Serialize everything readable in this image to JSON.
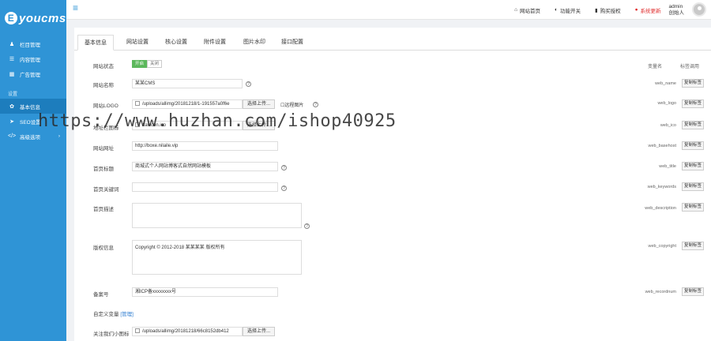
{
  "brand": {
    "logo_e": "E",
    "logo_text": "youcms"
  },
  "sidebar": {
    "items": [
      {
        "icon": "♟",
        "label": "栏目管理"
      },
      {
        "icon": "☰",
        "label": "内容管理"
      },
      {
        "icon": "▦",
        "label": "广告管理"
      }
    ],
    "section": "设置",
    "items2": [
      {
        "icon": "✿",
        "label": "基本信息"
      },
      {
        "icon": "➤",
        "label": "SEO设置"
      },
      {
        "icon": "</>",
        "label": "高级选项",
        "arrow": "›"
      }
    ]
  },
  "topbar": {
    "links": [
      {
        "icon": "⌂",
        "label": "网站首页"
      },
      {
        "icon": "◐",
        "label": "功能开关"
      },
      {
        "icon": "▮",
        "label": "购买授权"
      },
      {
        "icon": "●",
        "label": "系统更新"
      }
    ],
    "user": {
      "name": "admin",
      "role": "创始人"
    }
  },
  "tabs": [
    "基本信息",
    "网站设置",
    "核心设置",
    "附件设置",
    "图片水印",
    "接口配置"
  ],
  "headers": {
    "var": "变量名",
    "call": "标签调用"
  },
  "form": {
    "status": {
      "label": "网站状态",
      "on": "开启",
      "off": "关闭"
    },
    "name": {
      "label": "网站名称",
      "value": "某某CMS",
      "var": "web_name",
      "btn": "复制标签"
    },
    "logo": {
      "label": "网站LOGO",
      "value": "/uploads/allimg/20181218/1-191557a0f6e",
      "upload": "选择上传...",
      "remote": "远程图片",
      "var": "web_logo",
      "btn": "复制标签"
    },
    "ico": {
      "label": "地址栏图标",
      "value": "/favicon.ico",
      "upload": "选择上传...",
      "var": "web_ico",
      "btn": "复制标签"
    },
    "url": {
      "label": "网站网址",
      "value": "http://boxe.nilaile.vip",
      "var": "web_basehost",
      "btn": "复制标签"
    },
    "title": {
      "label": "首页标题",
      "value": "商城式个人网站博客式自然网站模板",
      "var": "web_title",
      "btn": "复制标签"
    },
    "keywords": {
      "label": "首页关键词",
      "value": "",
      "var": "web_keywords",
      "btn": "复制标签"
    },
    "description": {
      "label": "首页描述",
      "value": "",
      "var": "web_description",
      "btn": "复制标签"
    },
    "copyright": {
      "label": "版权信息",
      "value": "Copyright © 2012-2018 某某某某 版权所有",
      "var": "web_copyright",
      "btn": "复制标签"
    },
    "recordnum": {
      "label": "备案号",
      "value": "湘ICP备xxxxxxxx号",
      "var": "web_recordnum",
      "btn": "复制标签"
    },
    "custom": {
      "label": "自定义变量",
      "link": "[管理]"
    },
    "wechat": {
      "label": "关注我们小图标",
      "value": "/uploads/allimg/20181218/66c8152db412",
      "upload": "选择上传..."
    }
  },
  "watermark": "https://www.huzhan.com/ishop40925"
}
